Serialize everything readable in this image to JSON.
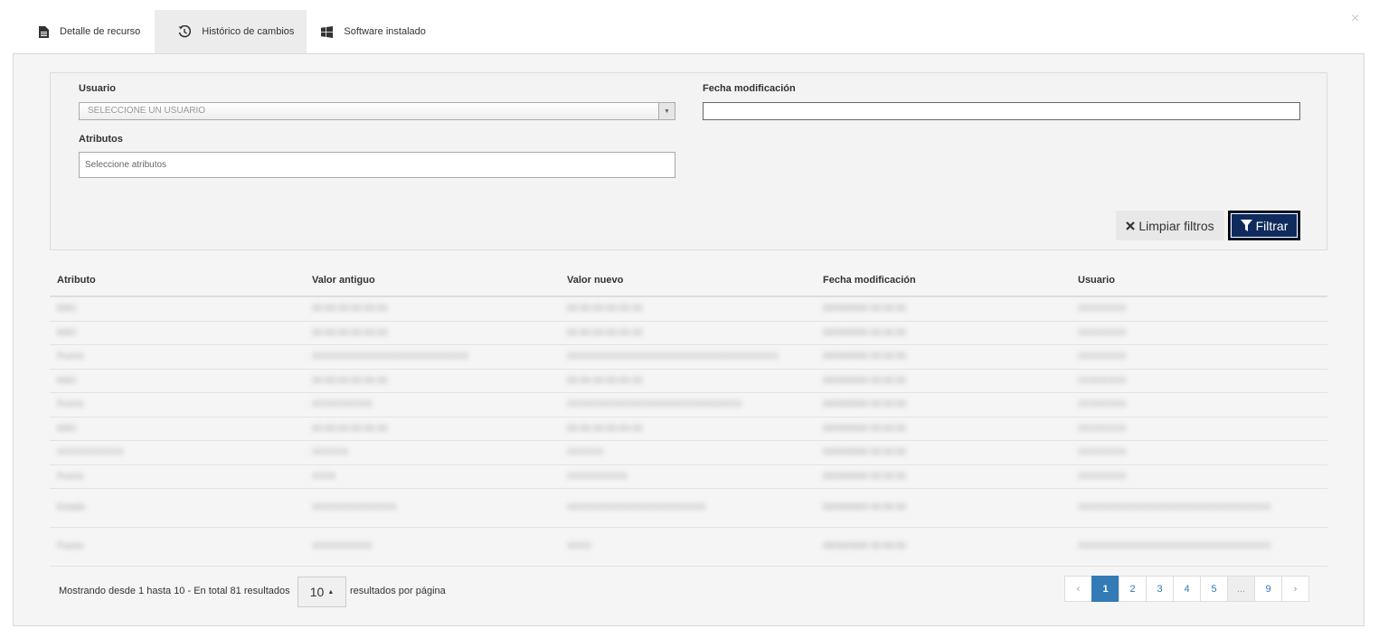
{
  "tabs": [
    {
      "label": "Detalle de recurso",
      "icon": "document-icon"
    },
    {
      "label": "Histórico de cambios",
      "icon": "history-icon",
      "active": true
    },
    {
      "label": "Software instalado",
      "icon": "windows-icon"
    }
  ],
  "close_label": "×",
  "filters": {
    "usuario_label": "Usuario",
    "usuario_placeholder": "SELECCIONE UN USUARIO",
    "fecha_label": "Fecha modificación",
    "fecha_value": "",
    "atributos_label": "Atributos",
    "atributos_placeholder": "Seleccione atributos",
    "clear_label": "Limpiar filtros",
    "filter_label": "Filtrar"
  },
  "table": {
    "headers": [
      "Atributo",
      "Valor antiguo",
      "Valor nuevo",
      "Fecha modificación",
      "Usuario"
    ],
    "rows": [
      [
        "MAC",
        "00-00-00-00-00-00",
        "00-00-00-00-00-00",
        "00/00/0000 00:00:00",
        "XXXXXXXX"
      ],
      [
        "MAC",
        "00-00-00-00-00-00",
        "00-00-00-00-00-00",
        "00/00/0000 00:00:00",
        "XXXXXXXX"
      ],
      [
        "Puerto",
        "XXXXXXXXXXXXXXXXXXXXXXXXXX",
        "XXXXXXXXXXXXXXXXXXXXXXXXXXXXXXXXXXX",
        "00/00/0000 00:00:00",
        "XXXXXXXX"
      ],
      [
        "MAC",
        "00-00-00-00-00-00",
        "00-00-00-00-00-00",
        "00/00/0000 00:00:00",
        "XXXXXXXX"
      ],
      [
        "Puerto",
        "XXXXXXXXXX",
        "XXXXXXXXXXXXXXXXXXXXXXXXXXXXX",
        "00/00/0000 00:00:00",
        "XXXXXXXX"
      ],
      [
        "MAC",
        "00-00-00-00-00-00",
        "00-00-00-00-00-00",
        "00/00/0000 00:00:00",
        "XXXXXXXX"
      ],
      [
        "XXXXXXXXXXX",
        "XXXXXX",
        "XXXXXX",
        "00/00/0000 00:00:00",
        "XXXXXXXX"
      ],
      [
        "Puerto",
        "XXXX",
        "XXXXXXXXXX",
        "00/00/0000 00:00:00",
        "XXXXXXXX"
      ],
      [
        "Estado",
        "XXXXXXXXXXXXXX",
        "XXXXXXXXXXXXXXXXXXXXXXX",
        "00/00/0000 00:00:00",
        "XXXXXXXXXXXXXXXXXXXXXXXXXXXXXXXX"
      ],
      [
        "Puerto",
        "XXXXXXXXXX",
        "XXXX",
        "00/00/0000 00:00:00",
        "XXXXXXXXXXXXXXXXXXXXXXXXXXXXXXXX"
      ]
    ]
  },
  "footer": {
    "info": "Mostrando desde 1 hasta 10 - En total 81 resultados",
    "page_size": "10",
    "page_size_label": "resultados por página"
  },
  "pagination": {
    "prev": "‹",
    "pages": [
      "1",
      "2",
      "3",
      "4",
      "5",
      "...",
      "9"
    ],
    "active": "1",
    "next": "›"
  }
}
